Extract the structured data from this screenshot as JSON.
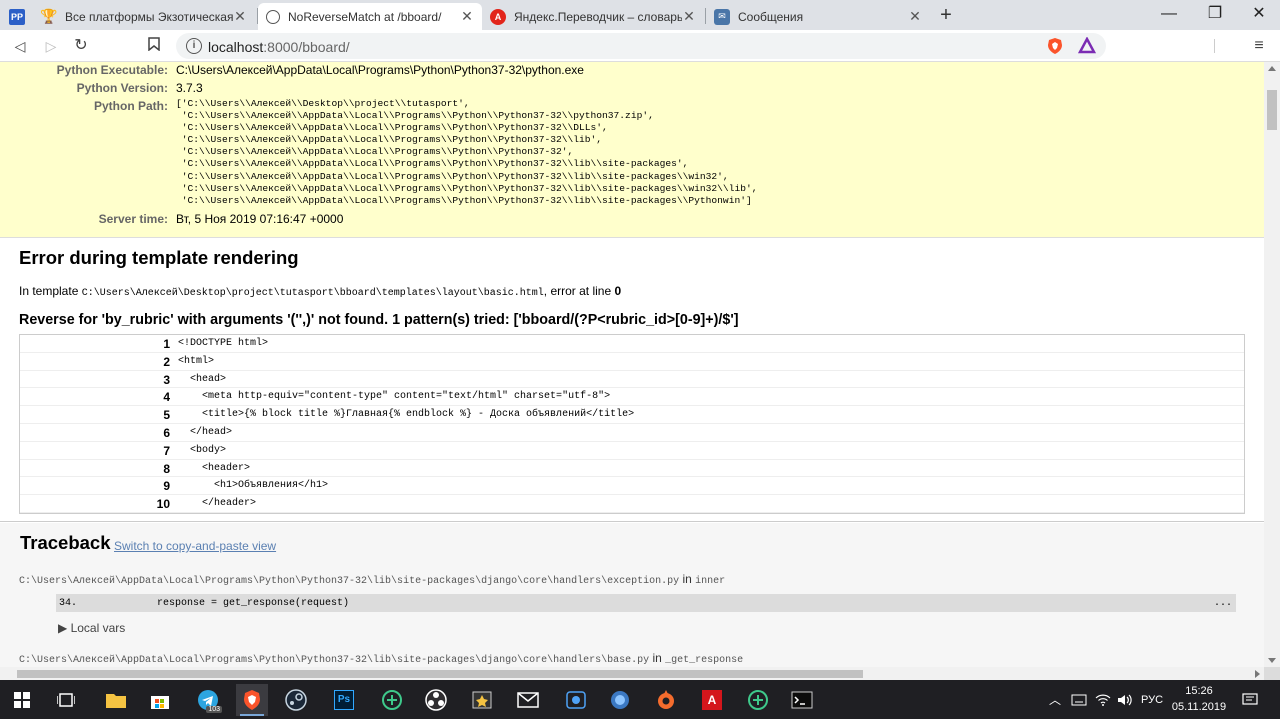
{
  "browser": {
    "tabs": [
      {
        "title": "Все платформы Экзотическая ко",
        "favicon": "trophy-icon",
        "active": false
      },
      {
        "title": "NoReverseMatch at /bboard/",
        "favicon": "globe-icon",
        "active": true
      },
      {
        "title": "Яндекс.Переводчик – словарь и о",
        "favicon": "yandex-translate-icon",
        "active": false
      },
      {
        "title": "Сообщения",
        "favicon": "vk-messages-icon",
        "active": false
      }
    ],
    "new_tab": "+",
    "window_controls": {
      "minimize": "—",
      "maximize": "❐",
      "close": "✕"
    },
    "url": {
      "host": "localhost",
      "port": ":8000",
      "path": "/bboard/"
    },
    "menu": "≡"
  },
  "meta": {
    "python_executable": {
      "label": "Python Executable:",
      "value": "C:\\Users\\Алексей\\AppData\\Local\\Programs\\Python\\Python37-32\\python.exe"
    },
    "python_version": {
      "label": "Python Version:",
      "value": "3.7.3"
    },
    "python_path": {
      "label": "Python Path:",
      "value": "['C:\\\\Users\\\\Алексей\\\\Desktop\\\\project\\\\tutasport',\n 'C:\\\\Users\\\\Алексей\\\\AppData\\\\Local\\\\Programs\\\\Python\\\\Python37-32\\\\python37.zip',\n 'C:\\\\Users\\\\Алексей\\\\AppData\\\\Local\\\\Programs\\\\Python\\\\Python37-32\\\\DLLs',\n 'C:\\\\Users\\\\Алексей\\\\AppData\\\\Local\\\\Programs\\\\Python\\\\Python37-32\\\\lib',\n 'C:\\\\Users\\\\Алексей\\\\AppData\\\\Local\\\\Programs\\\\Python\\\\Python37-32',\n 'C:\\\\Users\\\\Алексей\\\\AppData\\\\Local\\\\Programs\\\\Python\\\\Python37-32\\\\lib\\\\site-packages',\n 'C:\\\\Users\\\\Алексей\\\\AppData\\\\Local\\\\Programs\\\\Python\\\\Python37-32\\\\lib\\\\site-packages\\\\win32',\n 'C:\\\\Users\\\\Алексей\\\\AppData\\\\Local\\\\Programs\\\\Python\\\\Python37-32\\\\lib\\\\site-packages\\\\win32\\\\lib',\n 'C:\\\\Users\\\\Алексей\\\\AppData\\\\Local\\\\Programs\\\\Python\\\\Python37-32\\\\lib\\\\site-packages\\\\Pythonwin']"
    },
    "server_time": {
      "label": "Server time:",
      "value": "Вт, 5 Ноя 2019 07:16:47 +0000"
    }
  },
  "template_error": {
    "heading": "Error during template rendering",
    "in_template_prefix": "In template ",
    "template_path": "C:\\Users\\Алексей\\Desktop\\project\\tutasport\\bboard\\templates\\layout\\basic.html",
    "error_at_line_prefix": ", error at line ",
    "error_line": "0",
    "message": "Reverse for 'by_rubric' with arguments '('',)' not found. 1 pattern(s) tried: ['bboard/(?P<rubric_id>[0-9]+)/$']",
    "source_lines": [
      {
        "num": "1",
        "code": "<!DOCTYPE html>"
      },
      {
        "num": "2",
        "code": "<html>"
      },
      {
        "num": "3",
        "code": "  <head>"
      },
      {
        "num": "4",
        "code": "    <meta http-equiv=\"content-type\" content=\"text/html\" charset=\"utf-8\">"
      },
      {
        "num": "5",
        "code": "    <title>{% block title %}Главная{% endblock %} - Доска объявлений</title>"
      },
      {
        "num": "6",
        "code": "  </head>"
      },
      {
        "num": "7",
        "code": "  <body>"
      },
      {
        "num": "8",
        "code": "    <header>"
      },
      {
        "num": "9",
        "code": "      <h1>Объявления</h1>"
      },
      {
        "num": "10",
        "code": "    </header>"
      }
    ]
  },
  "traceback": {
    "heading": "Traceback",
    "switch_link": "Switch to copy-and-paste view",
    "frames": [
      {
        "file": "C:\\Users\\Алексей\\AppData\\Local\\Programs\\Python\\Python37-32\\lib\\site-packages\\django\\core\\handlers\\exception.py",
        "in": " in ",
        "function": "inner"
      },
      {
        "file": "C:\\Users\\Алексей\\AppData\\Local\\Programs\\Python\\Python37-32\\lib\\site-packages\\django\\core\\handlers\\base.py",
        "in": " in ",
        "function": "_get_response"
      }
    ],
    "context_line": {
      "num": "34.",
      "code": "response = get_response(request)",
      "ellipsis": "..."
    },
    "local_vars": "▶ Local vars"
  },
  "taskbar": {
    "language": "РУС",
    "time": "15:26",
    "date": "05.11.2019",
    "telegram_badge": "103"
  },
  "colors": {
    "meta_bg": "#ffffcc",
    "traceback_bg": "#f6f6f6",
    "link": "#5b80b2",
    "taskbar_bg": "#1f1f23"
  }
}
